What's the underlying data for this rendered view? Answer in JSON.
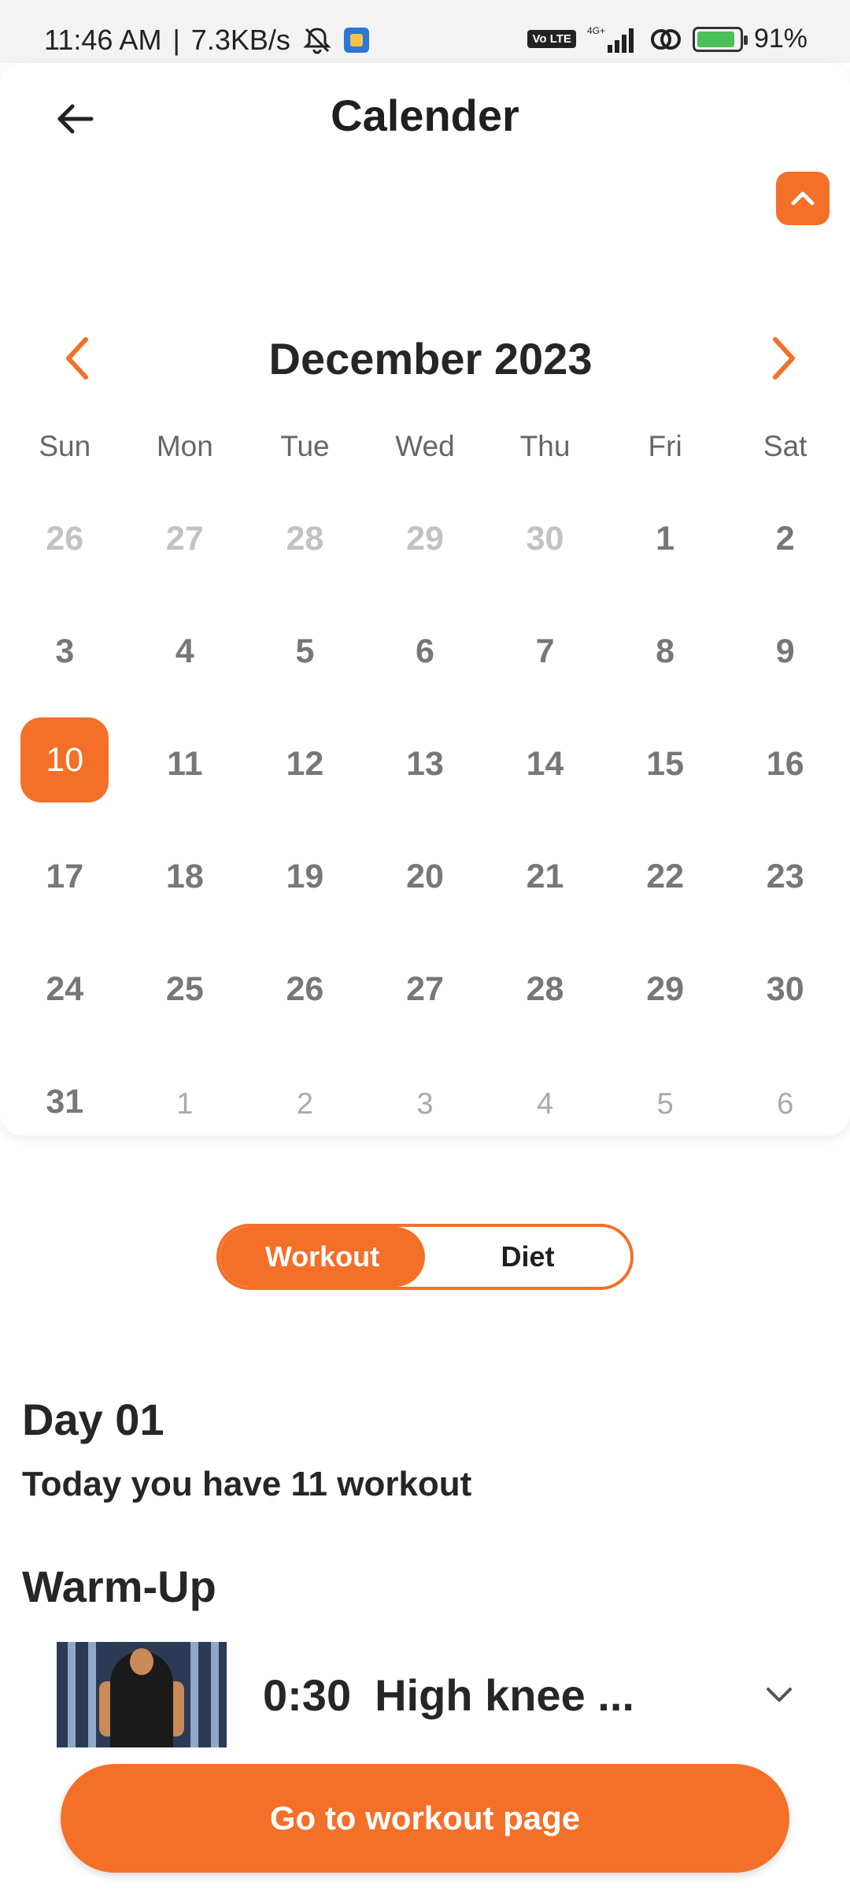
{
  "status_bar": {
    "time": "11:46 AM",
    "speed": "7.3KB/s",
    "network": "4G+",
    "volte": "Vo LTE",
    "battery": "91%"
  },
  "header": {
    "title": "Calender"
  },
  "calendar": {
    "month_label": "December 2023",
    "weekdays": [
      "Sun",
      "Mon",
      "Tue",
      "Wed",
      "Thu",
      "Fri",
      "Sat"
    ],
    "days": [
      "26",
      "27",
      "28",
      "29",
      "30",
      "1",
      "2",
      "3",
      "4",
      "5",
      "6",
      "7",
      "8",
      "9",
      "10",
      "11",
      "12",
      "13",
      "14",
      "15",
      "16",
      "17",
      "18",
      "19",
      "20",
      "21",
      "22",
      "23",
      "24",
      "25",
      "26",
      "27",
      "28",
      "29",
      "30",
      "31",
      "1",
      "2",
      "3",
      "4",
      "5",
      "6"
    ],
    "selected_day": "10"
  },
  "toggle": {
    "workout": "Workout",
    "diet": "Diet",
    "active": "Workout"
  },
  "plan": {
    "day_heading": "Day 01",
    "summary": "Today you have 11 workout",
    "section": "Warm-Up",
    "exercise": {
      "time": "0:30",
      "name": "High knee ..."
    }
  },
  "cta": {
    "label": "Go to workout page"
  },
  "colors": {
    "accent": "#f47028"
  }
}
